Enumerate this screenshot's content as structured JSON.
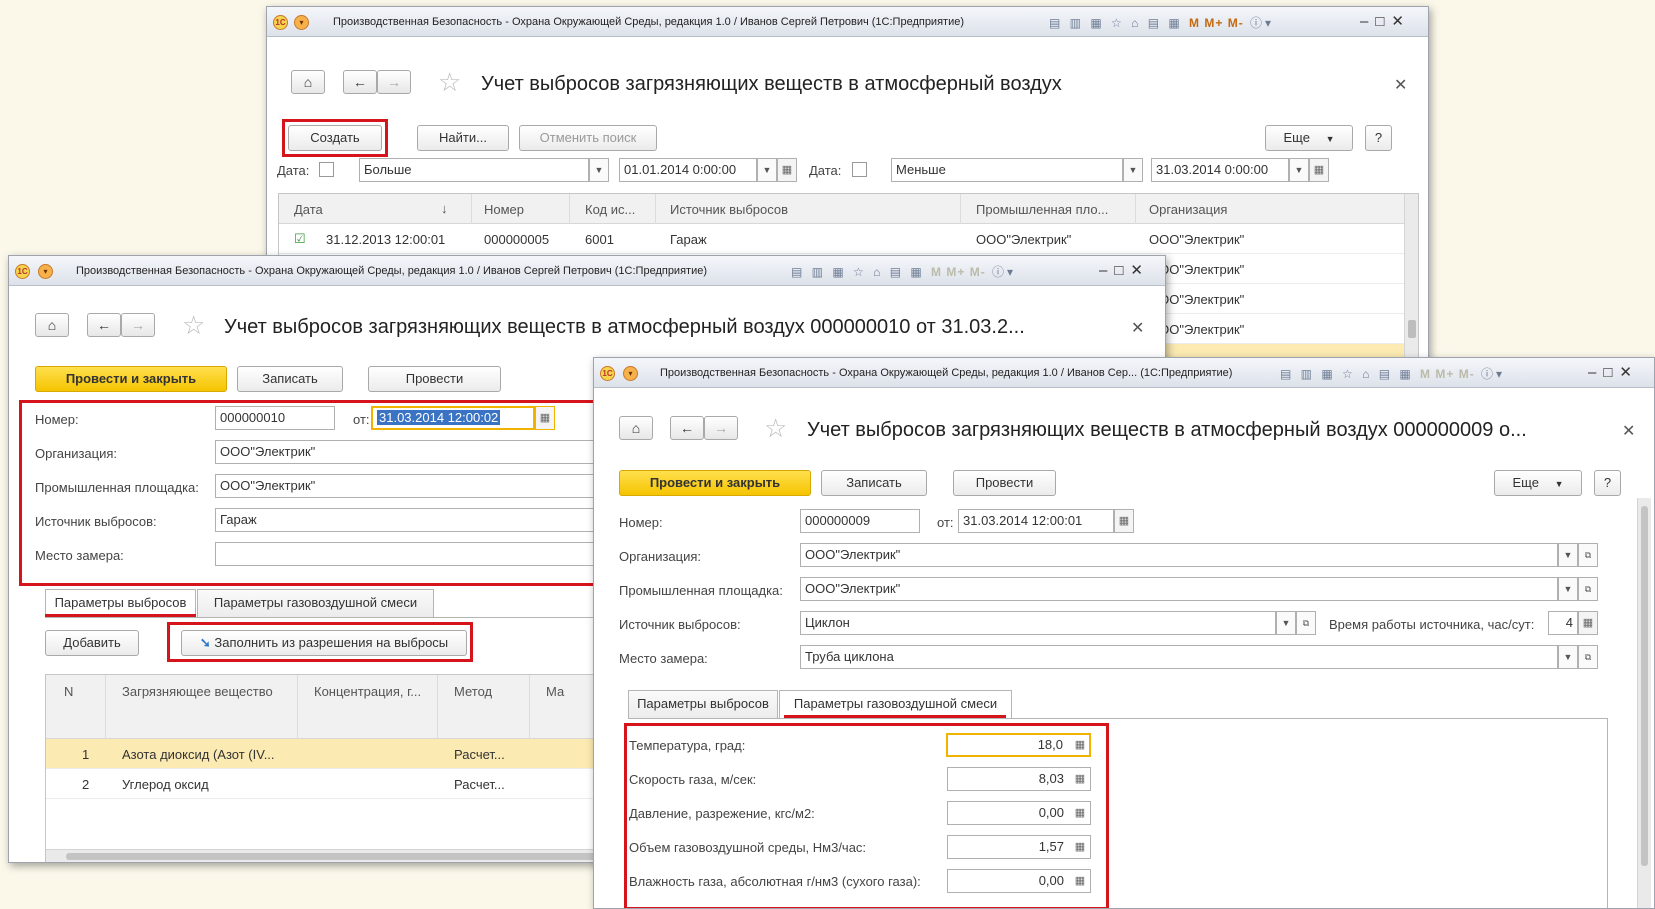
{
  "windows": {
    "list": {
      "app_title": "Производственная Безопасность - Охрана Окружающей Среды, редакция 1.0 / Иванов Сергей Петрович  (1С:Предприятие)",
      "form_title": "Учет выбросов загрязняющих веществ в атмосферный воздух",
      "toolbar": {
        "create": "Создать",
        "find": "Найти...",
        "cancel_search": "Отменить поиск",
        "more": "Еще",
        "help": "?"
      },
      "filter": {
        "date_label": "Дата:",
        "cond1": "Больше",
        "date1": "01.01.2014  0:00:00",
        "date2_label": "Дата:",
        "cond2": "Меньше",
        "date2": "31.03.2014  0:00:00"
      },
      "columns": [
        "Дата",
        "Номер",
        "Код ис...",
        "Источник выбросов",
        "Промышленная пло...",
        "Организация"
      ],
      "sort_arrow": "↓",
      "rows": [
        {
          "date": "31.12.2013 12:00:01",
          "number": "000000005",
          "code": "6001",
          "source": "Гараж",
          "site": "ООО\"Электрик\"",
          "org": "ООО\"Электрик\""
        },
        {
          "org": "ООО\"Электрик\""
        },
        {
          "org": "ООО\"Электрик\""
        },
        {
          "org": "ООО\"Электрик\""
        }
      ]
    },
    "doc10": {
      "app_title": "Производственная Безопасность - Охрана Окружающей Среды, редакция 1.0 / Иванов Сергей Петрович  (1С:Предприятие)",
      "form_title": "Учет выбросов загрязняющих веществ в атмосферный воздух 000000010 от 31.03.2...",
      "buttons": {
        "post_close": "Провести и закрыть",
        "save": "Записать",
        "post": "Провести"
      },
      "fields": {
        "number_label": "Номер:",
        "number": "000000010",
        "from_label": "от:",
        "date": "31.03.2014 12:00:02",
        "org_label": "Организация:",
        "org": "ООО\"Электрик\"",
        "site_label": "Промышленная площадка:",
        "site": "ООО\"Электрик\"",
        "source_label": "Источник выбросов:",
        "source": "Гараж",
        "place_label": "Место замера:",
        "place": ""
      },
      "tabs": [
        "Параметры выбросов",
        "Параметры газовоздушной смеси"
      ],
      "tab_buttons": {
        "add": "Добавить",
        "fill": "Заполнить из разрешения на выбросы"
      },
      "columns": [
        "N",
        "Загрязняющее вещество",
        "Концентрация, г...",
        "Метод",
        "Ма"
      ],
      "rows": [
        {
          "n": "1",
          "substance": "Азота диоксид (Азот (IV...",
          "method": "Расчет..."
        },
        {
          "n": "2",
          "substance": "Углерод оксид",
          "method": "Расчет..."
        }
      ]
    },
    "doc9": {
      "app_title": "Производственная Безопасность - Охрана Окружающей Среды, редакция 1.0 / Иванов Сер...  (1С:Предприятие)",
      "form_title": "Учет выбросов загрязняющих веществ в атмосферный воздух 000000009 о...",
      "buttons": {
        "post_close": "Провести и закрыть",
        "save": "Записать",
        "post": "Провести",
        "more": "Еще",
        "help": "?"
      },
      "fields": {
        "number_label": "Номер:",
        "number": "000000009",
        "from_label": "от:",
        "date": "31.03.2014 12:00:01",
        "org_label": "Организация:",
        "org": "ООО\"Электрик\"",
        "site_label": "Промышленная площадка:",
        "site": "ООО\"Электрик\"",
        "source_label": "Источник выбросов:",
        "source": "Циклон",
        "hours_label": "Время работы источника, час/сут:",
        "hours": "4",
        "place_label": "Место замера:",
        "place": "Труба циклона"
      },
      "tabs": [
        "Параметры выбросов",
        "Параметры газовоздушной смеси"
      ],
      "params": [
        {
          "label": "Температура, град:",
          "value": "18,0"
        },
        {
          "label": "Скорость газа, м/сек:",
          "value": "8,03"
        },
        {
          "label": "Давление, разрежение, кгс/м2:",
          "value": "0,00"
        },
        {
          "label": "Объем газовоздушной среды, Нм3/час:",
          "value": "1,57"
        },
        {
          "label": "Влажность газа, абсолютная г/нм3 (сухого газа):",
          "value": "0,00"
        }
      ]
    }
  },
  "colors": {
    "accent_red": "#d5141b",
    "primary_yellow": "#f5c300",
    "selected_row": "#fbeab2"
  }
}
